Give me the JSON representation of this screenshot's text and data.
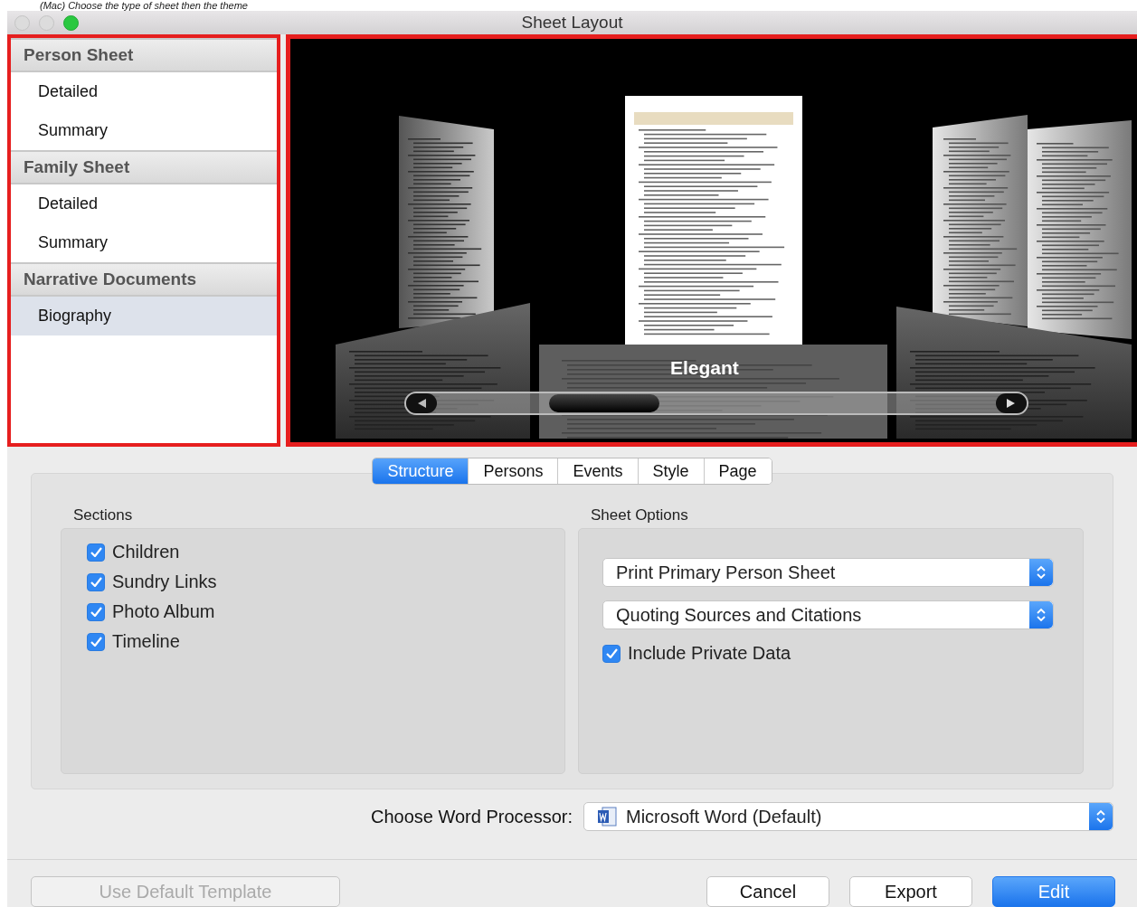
{
  "caption": "(Mac) Choose the type of sheet then the theme",
  "window": {
    "title": "Sheet Layout"
  },
  "sidebar": {
    "groups": [
      {
        "title": "Person Sheet",
        "items": [
          {
            "label": "Detailed",
            "selected": false
          },
          {
            "label": "Summary",
            "selected": false
          }
        ]
      },
      {
        "title": "Family Sheet",
        "items": [
          {
            "label": "Detailed",
            "selected": false
          },
          {
            "label": "Summary",
            "selected": false
          }
        ]
      },
      {
        "title": "Narrative Documents",
        "items": [
          {
            "label": "Biography",
            "selected": true
          }
        ]
      }
    ]
  },
  "preview": {
    "theme_name": "Elegant"
  },
  "tabs": [
    {
      "label": "Structure",
      "selected": true
    },
    {
      "label": "Persons",
      "selected": false
    },
    {
      "label": "Events",
      "selected": false
    },
    {
      "label": "Style",
      "selected": false
    },
    {
      "label": "Page",
      "selected": false
    }
  ],
  "sections": {
    "title": "Sections",
    "items": [
      {
        "label": "Children",
        "checked": true
      },
      {
        "label": "Sundry Links",
        "checked": true
      },
      {
        "label": "Photo Album",
        "checked": true
      },
      {
        "label": "Timeline",
        "checked": true
      }
    ]
  },
  "sheet_options": {
    "title": "Sheet Options",
    "selects": [
      {
        "value": "Print Primary Person Sheet"
      },
      {
        "value": "Quoting Sources and Citations"
      }
    ],
    "checkbox": {
      "label": "Include Private Data",
      "checked": true
    }
  },
  "word_processor": {
    "label": "Choose Word Processor:",
    "value": "Microsoft Word (Default)"
  },
  "footer": {
    "left": [
      {
        "label": "Use Default Template",
        "default": false,
        "disabled": true
      }
    ],
    "right": [
      {
        "label": "Cancel",
        "default": false,
        "disabled": false
      },
      {
        "label": "Export",
        "default": false,
        "disabled": false
      },
      {
        "label": "Edit",
        "default": true,
        "disabled": false
      }
    ]
  }
}
